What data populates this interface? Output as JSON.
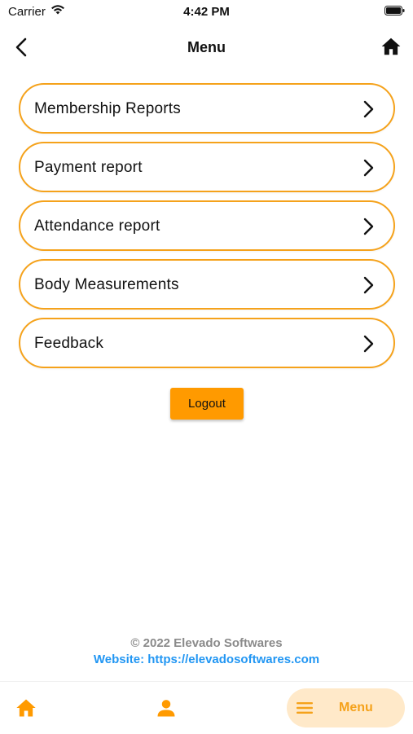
{
  "status_bar": {
    "carrier": "Carrier",
    "time": "4:42 PM"
  },
  "header": {
    "title": "Menu",
    "back_icon": "chevron-left-icon",
    "home_icon": "home-icon"
  },
  "menu": {
    "items": [
      {
        "label": "Membership Reports"
      },
      {
        "label": "Payment report"
      },
      {
        "label": "Attendance report"
      },
      {
        "label": "Body Measurements"
      },
      {
        "label": "Feedback"
      }
    ]
  },
  "logout": {
    "label": "Logout"
  },
  "footer": {
    "copyright": "© 2022 Elevado Softwares",
    "website": "Website: https://elevadosoftwares.com"
  },
  "bottom_nav": {
    "home_icon": "home-icon",
    "profile_icon": "person-icon",
    "menu_icon": "hamburger-menu-icon",
    "menu_label": "Menu"
  },
  "colors": {
    "accent": "#F5A21B",
    "button": "#FF9A00",
    "active_nav_bg": "#FFE9C9",
    "link": "#2196F3",
    "muted_text": "#8a8a8a"
  }
}
